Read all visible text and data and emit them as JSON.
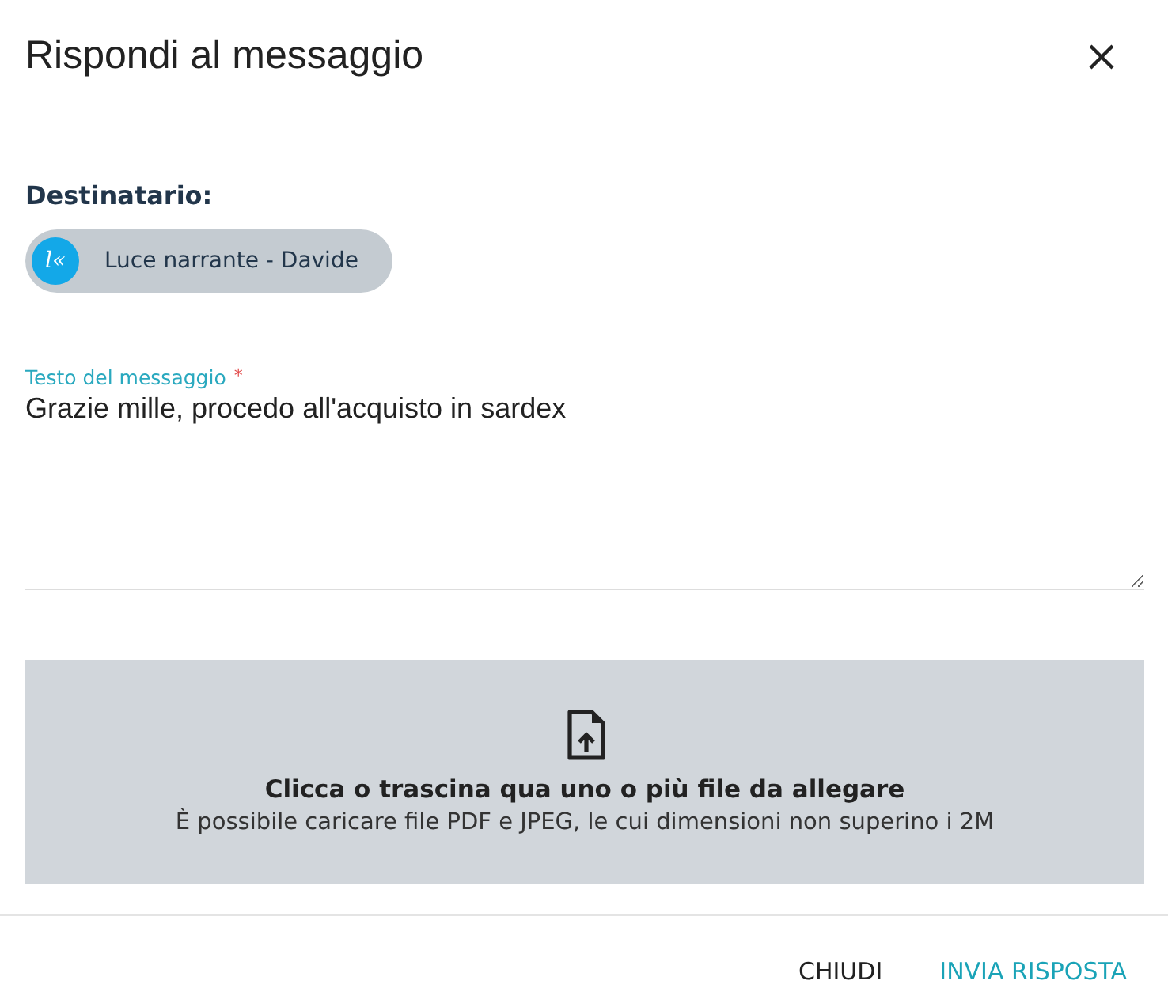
{
  "dialog": {
    "title": "Rispondi al messaggio"
  },
  "recipient": {
    "label": "Destinatario:",
    "avatar_text": "l«",
    "name": "Luce narrante - Davide"
  },
  "message": {
    "label": "Testo del messaggio",
    "required_mark": "*",
    "value": "Grazie mille, procedo all'acquisto in sardex"
  },
  "dropzone": {
    "title": "Clicca o trascina qua uno o più file da allegare",
    "hint": "È possibile caricare file PDF e JPEG, le cui dimensioni non superino i 2M"
  },
  "buttons": [
    {
      "label": "CHIUDI",
      "kind": "secondary"
    },
    {
      "label": "INVIA RISPOSTA",
      "kind": "primary"
    }
  ]
}
